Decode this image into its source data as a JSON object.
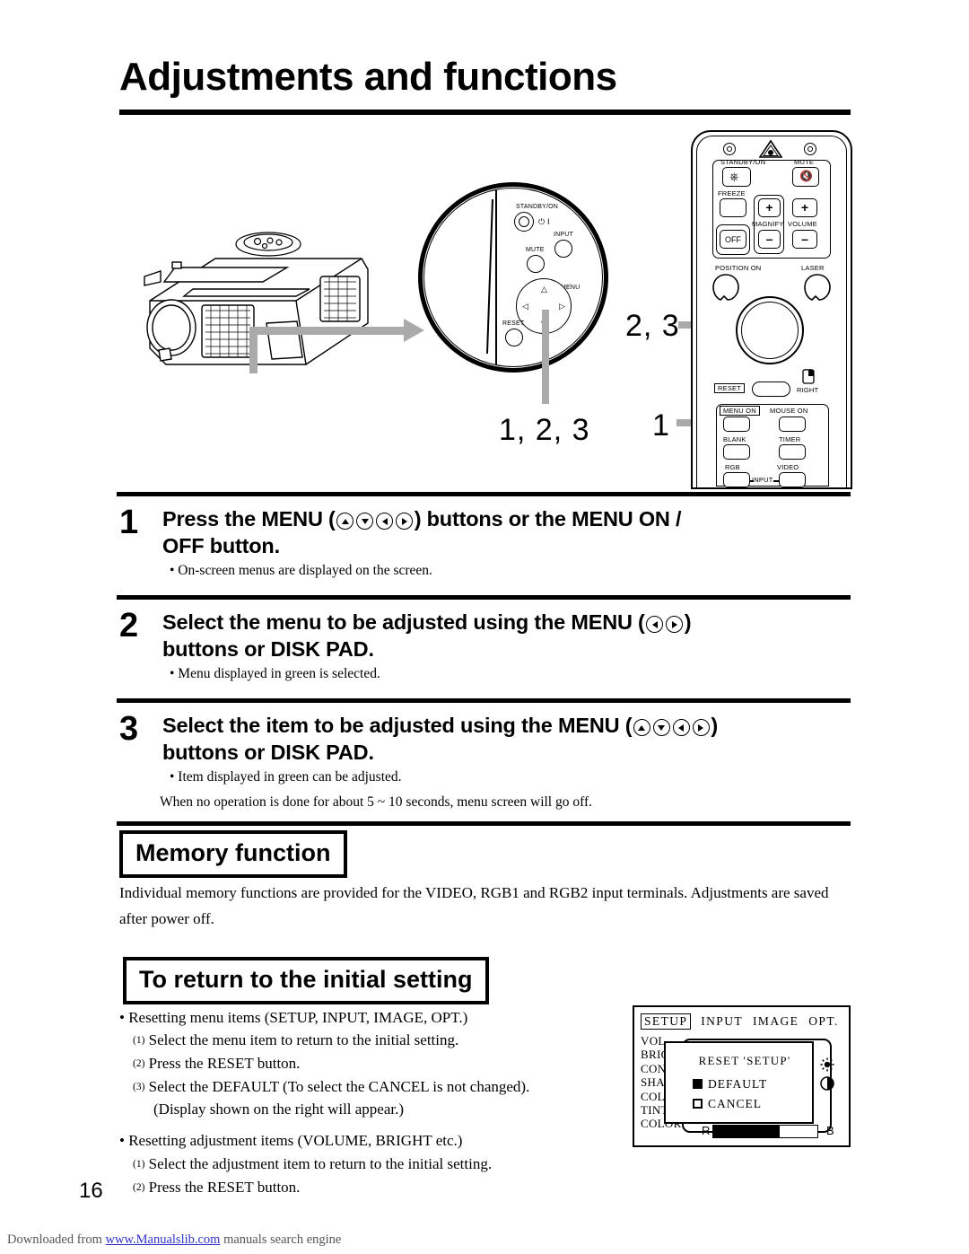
{
  "document": {
    "title": "Adjustments and functions",
    "page_number": "16"
  },
  "figure": {
    "callouts": [
      {
        "id": "projector-panel",
        "label": "1, 2, 3"
      },
      {
        "id": "remote-disk-pad",
        "label": "2, 3"
      },
      {
        "id": "remote-menu-on",
        "label": "1"
      }
    ],
    "control_panel": {
      "buttons": [
        {
          "label": "STANDBY/ON"
        },
        {
          "label": "INPUT"
        },
        {
          "label": "MUTE"
        },
        {
          "label": "MENU"
        },
        {
          "label": "RESET"
        }
      ],
      "power_glyph": "⏻ I"
    },
    "remote": {
      "buttons": [
        {
          "label": "STANDBY/ON"
        },
        {
          "label": "MUTE"
        },
        {
          "label": "FREEZE"
        },
        {
          "label": "MAGNIFY"
        },
        {
          "label": "VOLUME"
        },
        {
          "label": "OFF"
        },
        {
          "label": "POSITION  ON"
        },
        {
          "label": "LASER"
        },
        {
          "label": "RESET"
        },
        {
          "label": "RIGHT"
        },
        {
          "label": "MENU ON"
        },
        {
          "label": "MOUSE  ON"
        },
        {
          "label": "BLANK"
        },
        {
          "label": "TIMER"
        },
        {
          "label": "RGB"
        },
        {
          "label": "VIDEO"
        },
        {
          "label": "INPUT"
        }
      ],
      "plus": "+",
      "minus": "–"
    }
  },
  "steps": [
    {
      "number": "1",
      "head_before": "Press the MENU (",
      "icons": [
        "up",
        "down",
        "left",
        "right"
      ],
      "head_after": ") buttons or the MENU ON /",
      "head_line2": "OFF button.",
      "notes": [
        "• On-screen menus are displayed on the screen."
      ]
    },
    {
      "number": "2",
      "head_before": "Select the menu to be adjusted using the MENU (",
      "icons": [
        "left",
        "right"
      ],
      "head_after": ")",
      "head_line2": "buttons or DISK PAD.",
      "notes": [
        "• Menu displayed  in green is selected."
      ]
    },
    {
      "number": "3",
      "head_before": "Select the item to be adjusted using the MENU (",
      "icons": [
        "up",
        "down",
        "left",
        "right"
      ],
      "head_after": ")",
      "head_line2": "buttons or DISK PAD.",
      "notes": [
        "• Item displayed in green can be adjusted.",
        "When no operation is done for about 5 ~ 10 seconds, menu screen will go off."
      ]
    }
  ],
  "memory_section": {
    "heading": "Memory function",
    "body": "Individual memory functions are provided for the VIDEO, RGB1 and RGB2 input terminals. Adjustments are saved after power off."
  },
  "reset_section": {
    "heading": "To return to the initial setting",
    "bullet1": "• Resetting menu items (SETUP, INPUT, IMAGE, OPT.)",
    "bullet1_items": [
      {
        "num": "(1)",
        "text": "Select the menu item to return to the initial setting."
      },
      {
        "num": "(2)",
        "text": "Press the RESET  button."
      },
      {
        "num": "(3)",
        "text": "Select the DEFAULT (To select the CANCEL is not changed)."
      }
    ],
    "bullet1_extra": "(Display shown on the right will appear.)",
    "bullet2": "• Resetting adjustment items (VOLUME, BRIGHT etc.)",
    "bullet2_items": [
      {
        "num": "(1)",
        "text": "Select the adjustment item to return to the initial setting."
      },
      {
        "num": "(2)",
        "text": "Press the RESET button."
      }
    ]
  },
  "osd": {
    "tabs": [
      {
        "label": "SETUP",
        "selected": true
      },
      {
        "label": "INPUT",
        "selected": false
      },
      {
        "label": "IMAGE",
        "selected": false
      },
      {
        "label": "OPT.",
        "selected": false
      }
    ],
    "items": [
      "VOL",
      "BRIG",
      "CON",
      "SHA",
      "COL",
      "TINT",
      "COLOR BAL"
    ],
    "dialog": {
      "title": "RESET  'SETUP'",
      "options": [
        {
          "label": "DEFAULT",
          "selected": true
        },
        {
          "label": "CANCEL",
          "selected": false
        }
      ]
    },
    "color_bal": {
      "left_label": "R",
      "right_label": "B"
    },
    "icons": [
      "brightness-icon",
      "contrast-icon"
    ]
  },
  "footer": {
    "prefix": "Downloaded from ",
    "link": "www.Manualslib.com",
    "suffix": " manuals search engine"
  }
}
